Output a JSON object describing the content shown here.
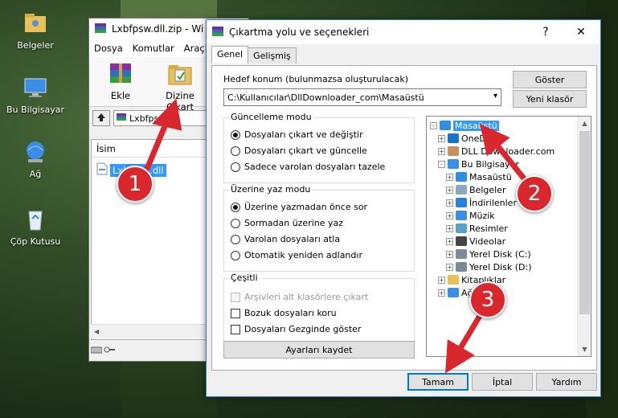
{
  "desktop": {
    "icons": [
      {
        "label": "Belgeler",
        "icon": "folder-user-icon"
      },
      {
        "label": "Bu Bilgisayar",
        "icon": "computer-icon"
      },
      {
        "label": "Ağ",
        "icon": "network-icon"
      },
      {
        "label": "Çöp Kutusu",
        "icon": "recycle-bin-icon"
      }
    ]
  },
  "winrar": {
    "title": "Lxbfpsw.dll.zip - Wi",
    "menu": [
      "Dosya",
      "Komutlar",
      "Araçla"
    ],
    "toolbar": {
      "add_label": "Ekle",
      "extract_label": "Dizine Çıkart"
    },
    "address": "Lxbfpsw.dl",
    "list_header": "İsim",
    "file_name": "Lxbfpsw.dll"
  },
  "dialog": {
    "title": "Çıkartma yolu ve seçenekleri",
    "help_button": "?",
    "close_button": "✕",
    "tabs": [
      "Genel",
      "Gelişmiş"
    ],
    "target_label": "Hedef konum (bulunmazsa oluşturulacak)",
    "target_value": "C:\\Kullanıcılar\\DllDownloader_com\\Masaüstü",
    "show_button": "Göster",
    "new_folder_button": "Yeni klasör",
    "update_mode": {
      "title": "Güncelleme modu",
      "options": [
        "Dosyaları çıkart ve değiştir",
        "Dosyaları çıkart ve güncelle",
        "Sadece varolan dosyaları tazele"
      ],
      "selected": 0
    },
    "overwrite_mode": {
      "title": "Üzerine yaz modu",
      "options": [
        "Üzerine yazmadan önce sor",
        "Sormadan üzerine yaz",
        "Varolan dosyaları atla",
        "Otomatik yeniden adlandır"
      ],
      "selected": 0
    },
    "misc": {
      "title": "Çeşitli",
      "options": [
        "Arşivleri alt klasörlere çıkart",
        "Bozuk dosyaları koru",
        "Dosyaları Gezginde göster"
      ],
      "disabled": [
        true,
        false,
        false
      ]
    },
    "save_settings_button": "Ayarları kaydet",
    "tree": [
      {
        "label": "Masaüstü",
        "icon": "desktop-folder-icon",
        "level": 0,
        "expander": "-",
        "selected": true
      },
      {
        "label": "OneDrive",
        "icon": "onedrive-icon",
        "level": 1,
        "expander": "+"
      },
      {
        "label": "DLL Downloader.com",
        "icon": "user-icon",
        "level": 1,
        "expander": "+"
      },
      {
        "label": "Bu Bilgisayar",
        "icon": "computer-icon",
        "level": 1,
        "expander": "-"
      },
      {
        "label": "Masaüstü",
        "icon": "desktop-folder-icon",
        "level": 2,
        "expander": "+"
      },
      {
        "label": "Belgeler",
        "icon": "documents-icon",
        "level": 2,
        "expander": "+"
      },
      {
        "label": "İndirilenler",
        "icon": "downloads-icon",
        "level": 2,
        "expander": "+"
      },
      {
        "label": "Müzik",
        "icon": "music-icon",
        "level": 2,
        "expander": "+"
      },
      {
        "label": "Resimler",
        "icon": "pictures-icon",
        "level": 2,
        "expander": "+"
      },
      {
        "label": "Videolar",
        "icon": "videos-icon",
        "level": 2,
        "expander": "+"
      },
      {
        "label": "Yerel Disk (C:)",
        "icon": "drive-c-icon",
        "level": 2,
        "expander": "+"
      },
      {
        "label": "Yerel Disk (D:)",
        "icon": "drive-d-icon",
        "level": 2,
        "expander": "+"
      },
      {
        "label": "Kitaplıklar",
        "icon": "libraries-icon",
        "level": 1,
        "expander": "+"
      },
      {
        "label": "Ağ",
        "icon": "network-icon",
        "level": 1,
        "expander": "+"
      }
    ],
    "ok_button": "Tamam",
    "cancel_button": "İptal",
    "help_btn": "Yardım"
  },
  "annotations": {
    "markers": [
      "1",
      "2",
      "3"
    ],
    "color": "#d9272e"
  }
}
